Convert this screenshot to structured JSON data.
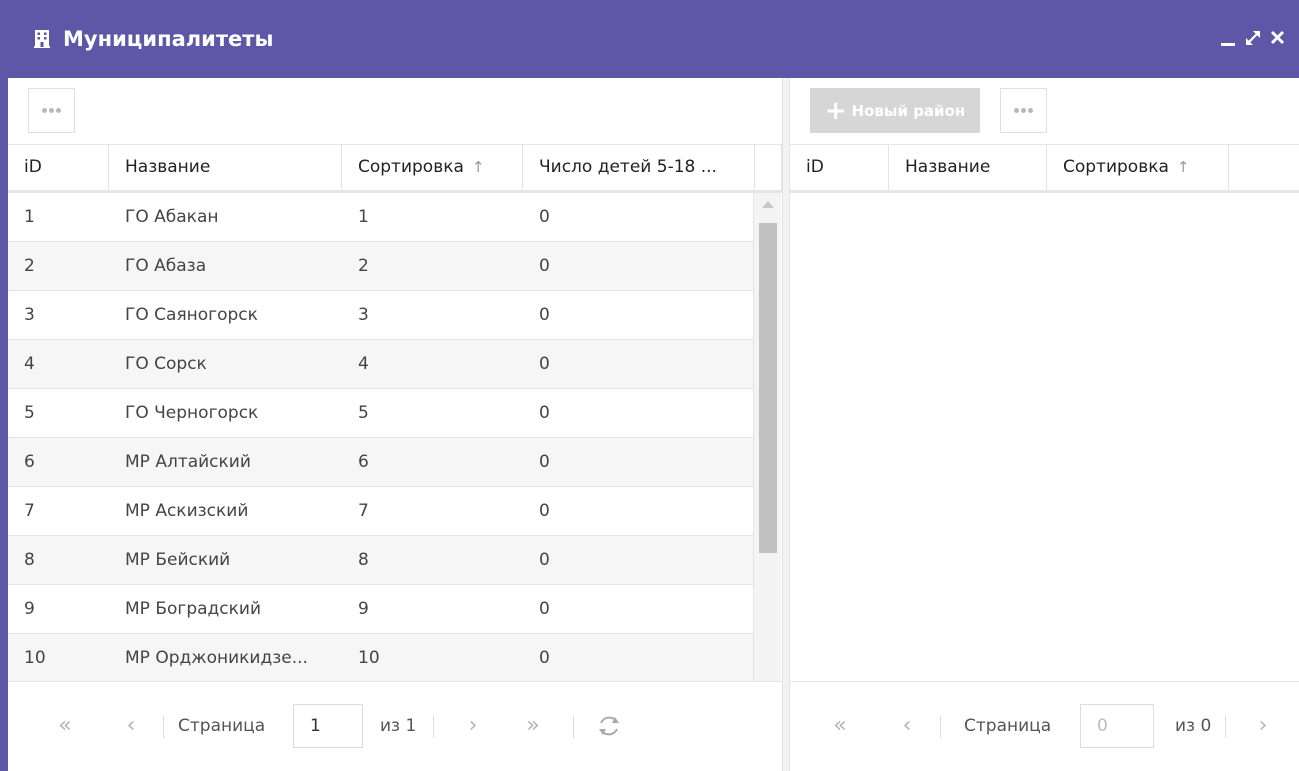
{
  "window": {
    "title": "Муниципалитеты",
    "title_bg": "#5e57a7"
  },
  "left": {
    "columns": [
      "iD",
      "Название",
      "Сортировка",
      "Число детей 5-18 ..."
    ],
    "sort_icon": "arrow-up-icon",
    "rows": [
      [
        "1",
        "ГО Абакан",
        "1",
        "0"
      ],
      [
        "2",
        "ГО Абаза",
        "2",
        "0"
      ],
      [
        "3",
        "ГО Саяногорск",
        "3",
        "0"
      ],
      [
        "4",
        "ГО Сорск",
        "4",
        "0"
      ],
      [
        "5",
        "ГО Черногорск",
        "5",
        "0"
      ],
      [
        "6",
        "МР Алтайский",
        "6",
        "0"
      ],
      [
        "7",
        "МР Аскизский",
        "7",
        "0"
      ],
      [
        "8",
        "МР Бейский",
        "8",
        "0"
      ],
      [
        "9",
        "МР Боградский",
        "9",
        "0"
      ],
      [
        "10",
        "МР Орджоникидзе...",
        "10",
        "0"
      ]
    ],
    "pager": {
      "first": "«",
      "prev": "‹",
      "page_label": "Страница",
      "page_value": "1",
      "of_label": "из 1",
      "next": "›",
      "last": "»",
      "refresh_icon": "refresh-icon"
    }
  },
  "right": {
    "new_button": "Новый район",
    "columns": [
      "iD",
      "Название",
      "Сортировка"
    ],
    "pager": {
      "first": "«",
      "prev": "‹",
      "page_label": "Страница",
      "page_placeholder": "0",
      "of_label": "из 0",
      "next": "›"
    }
  }
}
